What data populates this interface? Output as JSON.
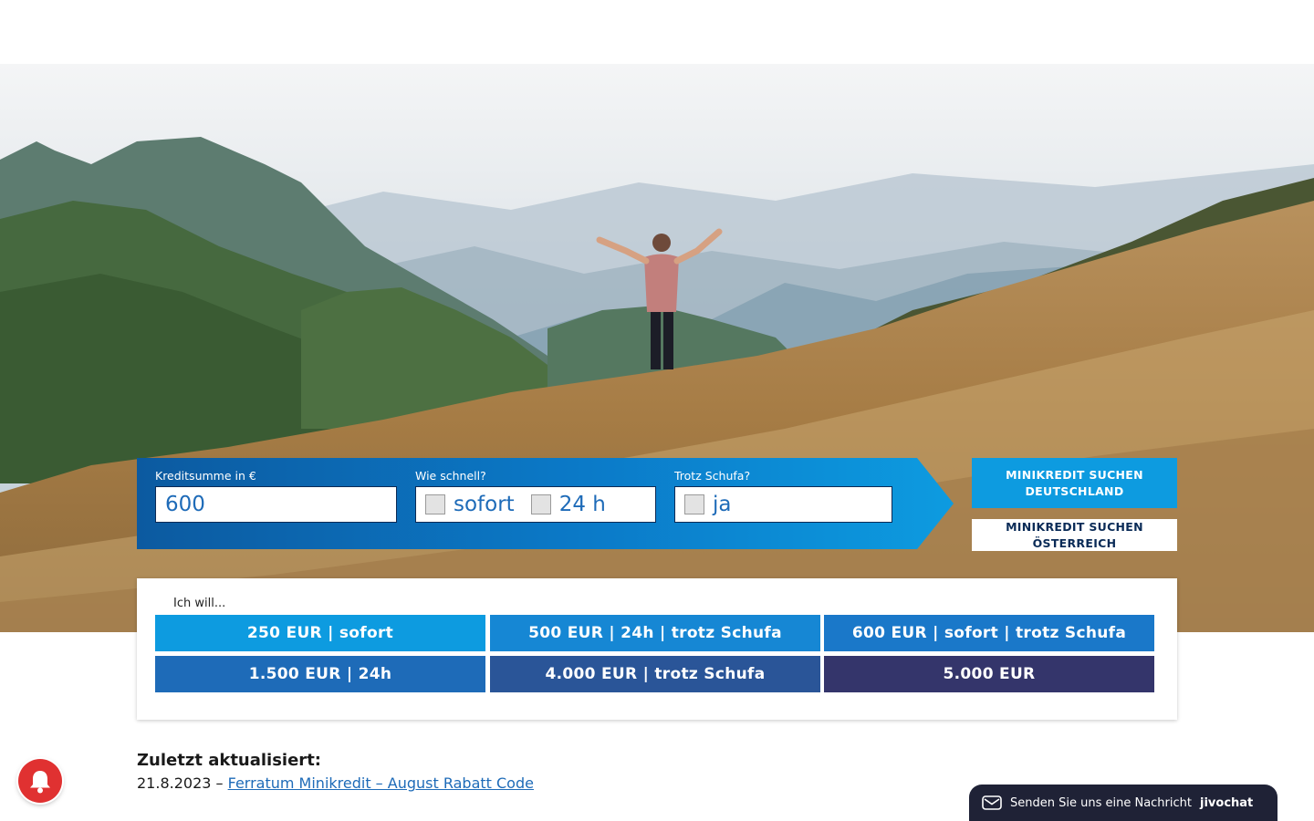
{
  "search": {
    "amount_label": "Kreditsumme in €",
    "amount_value": "600",
    "speed_label": "Wie schnell?",
    "speed_options": [
      "sofort",
      "24 h"
    ],
    "schufa_label": "Trotz Schufa?",
    "schufa_option": "ja",
    "cta_germany": "MINIKREDIT SUCHEN DEUTSCHLAND",
    "cta_austria": "MINIKREDIT SUCHEN ÖSTERREICH"
  },
  "quick_picks": {
    "label": "Ich will...",
    "items": [
      {
        "label": "250 EUR | sofort",
        "color": "#0d9be0"
      },
      {
        "label": "500 EUR | 24h | trotz Schufa",
        "color": "#1687d4"
      },
      {
        "label": "600 EUR | sofort | trotz Schufa",
        "color": "#1a78c9"
      },
      {
        "label": "1.500 EUR | 24h",
        "color": "#1e6bb8"
      },
      {
        "label": "4.000 EUR | trotz Schufa",
        "color": "#2a5598"
      },
      {
        "label": "5.000 EUR",
        "color": "#34356b"
      }
    ]
  },
  "updates": {
    "title": "Zuletzt aktualisiert:",
    "date_prefix": "21.8.2023 – ",
    "link_text": "Ferratum Minikredit – August Rabatt Code"
  },
  "chat": {
    "text": "Senden Sie uns eine Nachricht",
    "brand": "jivochat"
  },
  "icons": {
    "notification": "bell-icon",
    "chat": "envelope-icon"
  }
}
